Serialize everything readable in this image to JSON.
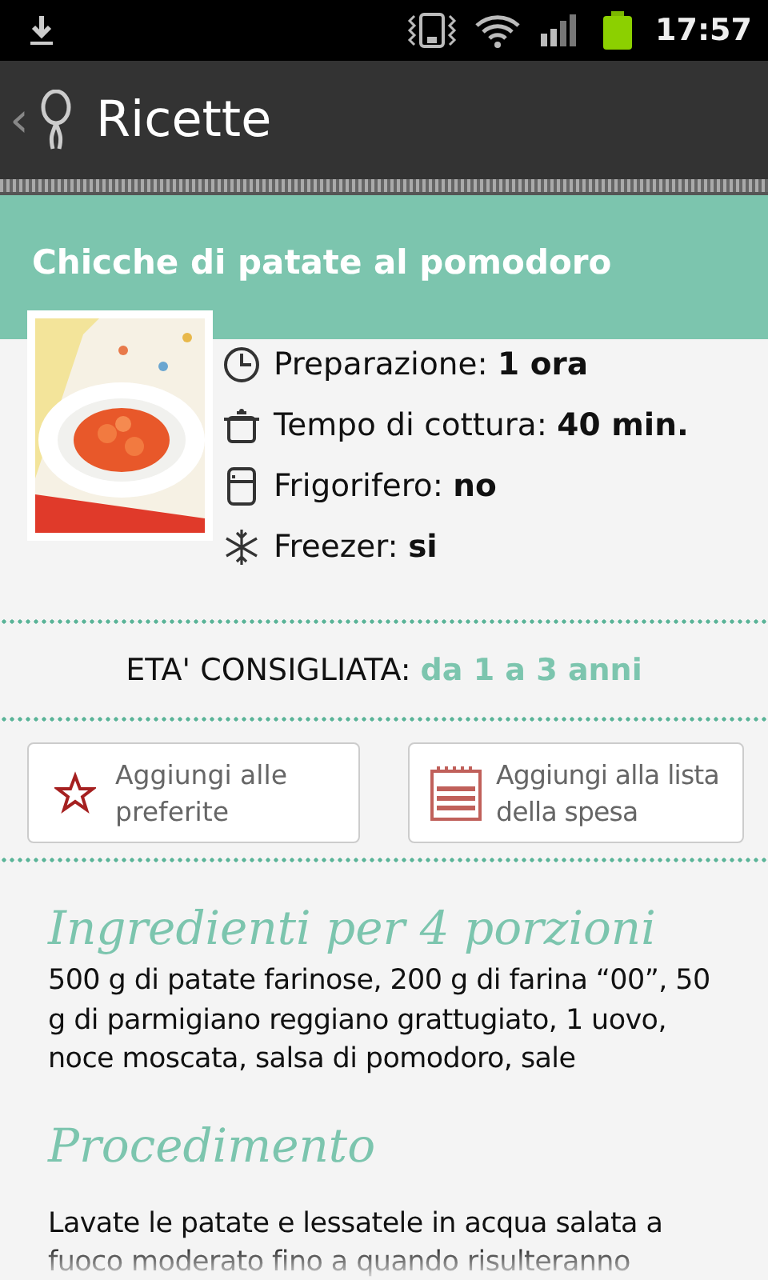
{
  "status_bar": {
    "time": "17:57"
  },
  "action_bar": {
    "back": "‹",
    "title": "Ricette"
  },
  "recipe": {
    "title": "Chicche di patate al pomodoro",
    "info": [
      {
        "kind": "clock",
        "text": "Preparazione: **1 ora**"
      },
      {
        "kind": "pot",
        "text": "Tempo di cottura: **40 min.**"
      },
      {
        "kind": "fridge",
        "text": "Frigorifero: **no**"
      },
      {
        "kind": "snowflake",
        "text": "Freezer: **si**"
      }
    ],
    "age": {
      "label": "ETA' CONSIGLIATA:",
      "value": "da 1 a 3 anni"
    },
    "buttons": [
      {
        "kind": "star",
        "label": "Aggiungi alle preferite"
      },
      {
        "kind": "list",
        "label": "Aggiungi alla lista della spesa"
      }
    ],
    "sections": [
      {
        "heading": "Ingredienti per 4 porzioni",
        "text": "500 g di patate farinose, 200 g di farina “00”, 50 g di parmigiano reggiano grattugiato, 1 uovo, noce moscata, salsa di pomodoro, sale"
      },
      {
        "heading": "Procedimento",
        "text": "Lavate le patate e lessatele in acqua salata a fuoco moderato fino a quando risulteranno"
      }
    ]
  }
}
